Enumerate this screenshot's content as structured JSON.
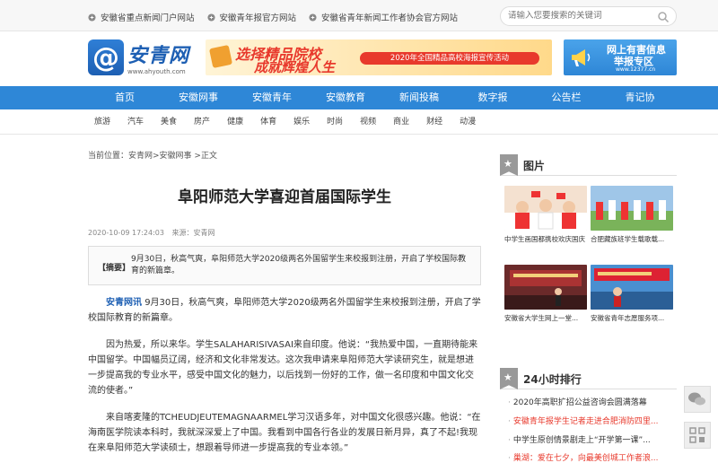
{
  "topbar": {
    "links": [
      {
        "icon": "link-icon",
        "label": "安徽省重点新闻门户网站"
      },
      {
        "icon": "link-icon",
        "label": "安徽青年报官方网站"
      },
      {
        "icon": "link-icon",
        "label": "安徽省青年新闻工作者协会官方网站"
      }
    ],
    "search_placeholder": "请输入您要搜索的关键词"
  },
  "logo": {
    "symbol": "@",
    "name": "安青网",
    "url": "www.ahyouth.com"
  },
  "banner": {
    "line1": "选择精品院校",
    "line2": "成就辉煌人生",
    "pill": "2020年全国精品高校海报宣传活动"
  },
  "report": {
    "line1": "网上有害信息",
    "line2": "举报专区",
    "url": "www.12377.cn"
  },
  "nav": [
    "首页",
    "安徽网事",
    "安徽青年",
    "安徽教育",
    "新闻投稿",
    "数字报",
    "公告栏",
    "青记协"
  ],
  "subnav": [
    "旅游",
    "汽车",
    "美食",
    "房产",
    "健康",
    "体育",
    "娱乐",
    "时尚",
    "视频",
    "商业",
    "财经",
    "动漫"
  ],
  "article": {
    "breadcrumb": "当前位置：安青网>安徽网事 >正文",
    "title": "阜阳师范大学喜迎首届国际学生",
    "datetime": "2020-10-09 17:24:03",
    "source": "来源：安青网",
    "summary_tag": "【摘要】",
    "summary": "9月30日，秋高气爽，阜阳师范大学2020级两名外国留学生来校报到注册，开启了学校国际教育的新篇章。",
    "lead": "安青网讯",
    "p1": "9月30日，秋高气爽，阜阳师范大学2020级两名外国留学生来校报到注册，开启了学校国际教育的新篇章。",
    "p2": "因为热爱，所以来华。学生SALAHARISIVASAI来自印度。他说：“我热爱中国，一直期待能来中国留学。中国幅员辽阔，经济和文化非常发达。这次我申请来阜阳师范大学读研究生，就是想进一步提高我的专业水平，感受中国文化的魅力，以后找到一份好的工作，做一名印度和中国文化交流的使者。”",
    "p3": "来自喀麦隆的TCHEUDJEUTEMAGNAARMEL学习汉语多年，对中国文化很感兴趣。他说：“在海南医学院读本科时，我就深深爱上了中国。我看到中国各行各业的发展日新月异，真了不起!我现在来阜阳师范大学读硕士，想跟着导师进一步提高我的专业本领。”"
  },
  "sidebar": {
    "pics_title": "图片",
    "pics": [
      {
        "caption": "中学生画国都携校欢庆国庆"
      },
      {
        "caption": "合肥藏族班学生载歌载..."
      },
      {
        "caption": "安徽省大学生网上一堂..."
      },
      {
        "caption": "安徽省青年志愿服务项..."
      }
    ],
    "rank_title": "24小时排行",
    "rank": [
      {
        "text": "2020年高职扩招公益咨询会圆满落幕",
        "hot": false
      },
      {
        "text": "安徽青年报学生记者走进合肥消防四里...",
        "hot": true
      },
      {
        "text": "中学生原创情景剧走上“开学第一课”...",
        "hot": false
      },
      {
        "text": "巢湖：爱在七夕，向最美创城工作者浪...",
        "hot": true
      }
    ]
  },
  "colors": {
    "brand": "#2e87d7",
    "hot": "#e8392c",
    "link": "#1d5fb3"
  }
}
